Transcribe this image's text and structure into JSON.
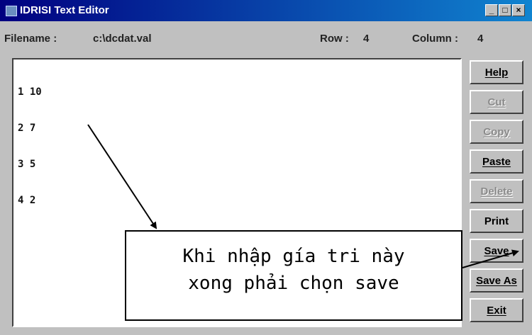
{
  "window": {
    "title": "IDRISI Text Editor",
    "minimize": "_",
    "maximize": "□",
    "close": "×"
  },
  "info": {
    "filename_label": "Filename :",
    "filename_value": "c:\\dcdat.val",
    "row_label": "Row :",
    "row_value": "4",
    "column_label": "Column :",
    "column_value": "4"
  },
  "editor": {
    "lines": [
      "1 10",
      "2 7",
      "3 5",
      "4 2"
    ]
  },
  "buttons": {
    "help": "Help",
    "cut": "Cut",
    "copy": "Copy",
    "paste": "Paste",
    "delete": "Delete",
    "print": "Print",
    "save": "Save",
    "save_as": "Save As",
    "exit": "Exit"
  },
  "annotation": {
    "line1": "Khi nhập gía tri này",
    "line2": "xong phải chọn save"
  }
}
